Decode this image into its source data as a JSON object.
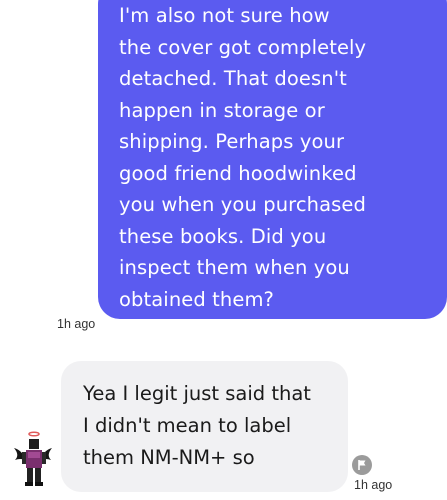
{
  "conversation": {
    "sent_message": {
      "lines": [
        "I'm also not sure how",
        "the cover got completely",
        "detached. That doesn't",
        "happen in storage or",
        "shipping. Perhaps your",
        "good friend hoodwinked",
        "you when you purchased",
        "these books. Did you",
        "inspect them when you",
        "obtained them?"
      ],
      "timestamp": "1h ago",
      "color": "#5b5bf0"
    },
    "received_message": {
      "lines": [
        "Yea I legit just said that",
        "I didn't mean to label",
        "them NM-NM+ so"
      ],
      "timestamp": "1h ago",
      "color": "#f1f1f3"
    },
    "icons": {
      "avatar": "user-avatar",
      "report": "flag-icon"
    }
  }
}
